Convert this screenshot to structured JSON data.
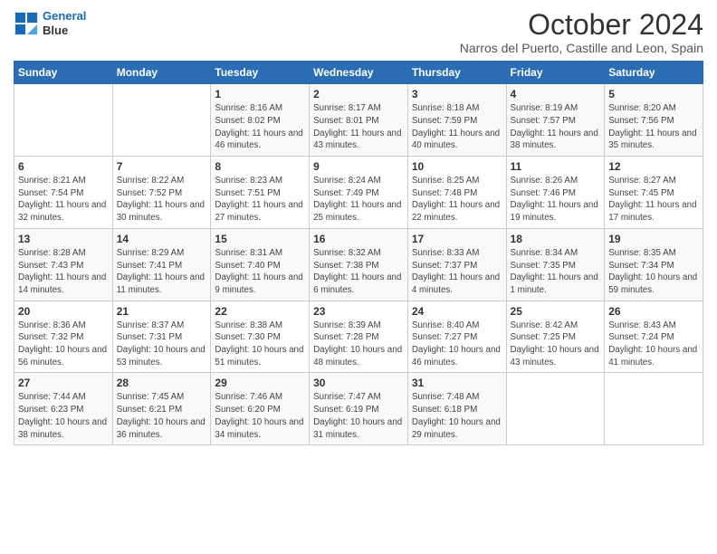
{
  "header": {
    "logo_line1": "General",
    "logo_line2": "Blue",
    "title": "October 2024",
    "subtitle": "Narros del Puerto, Castille and Leon, Spain"
  },
  "calendar": {
    "days_of_week": [
      "Sunday",
      "Monday",
      "Tuesday",
      "Wednesday",
      "Thursday",
      "Friday",
      "Saturday"
    ],
    "weeks": [
      [
        {
          "day": "",
          "info": ""
        },
        {
          "day": "",
          "info": ""
        },
        {
          "day": "1",
          "info": "Sunrise: 8:16 AM\nSunset: 8:02 PM\nDaylight: 11 hours and 46 minutes."
        },
        {
          "day": "2",
          "info": "Sunrise: 8:17 AM\nSunset: 8:01 PM\nDaylight: 11 hours and 43 minutes."
        },
        {
          "day": "3",
          "info": "Sunrise: 8:18 AM\nSunset: 7:59 PM\nDaylight: 11 hours and 40 minutes."
        },
        {
          "day": "4",
          "info": "Sunrise: 8:19 AM\nSunset: 7:57 PM\nDaylight: 11 hours and 38 minutes."
        },
        {
          "day": "5",
          "info": "Sunrise: 8:20 AM\nSunset: 7:56 PM\nDaylight: 11 hours and 35 minutes."
        }
      ],
      [
        {
          "day": "6",
          "info": "Sunrise: 8:21 AM\nSunset: 7:54 PM\nDaylight: 11 hours and 32 minutes."
        },
        {
          "day": "7",
          "info": "Sunrise: 8:22 AM\nSunset: 7:52 PM\nDaylight: 11 hours and 30 minutes."
        },
        {
          "day": "8",
          "info": "Sunrise: 8:23 AM\nSunset: 7:51 PM\nDaylight: 11 hours and 27 minutes."
        },
        {
          "day": "9",
          "info": "Sunrise: 8:24 AM\nSunset: 7:49 PM\nDaylight: 11 hours and 25 minutes."
        },
        {
          "day": "10",
          "info": "Sunrise: 8:25 AM\nSunset: 7:48 PM\nDaylight: 11 hours and 22 minutes."
        },
        {
          "day": "11",
          "info": "Sunrise: 8:26 AM\nSunset: 7:46 PM\nDaylight: 11 hours and 19 minutes."
        },
        {
          "day": "12",
          "info": "Sunrise: 8:27 AM\nSunset: 7:45 PM\nDaylight: 11 hours and 17 minutes."
        }
      ],
      [
        {
          "day": "13",
          "info": "Sunrise: 8:28 AM\nSunset: 7:43 PM\nDaylight: 11 hours and 14 minutes."
        },
        {
          "day": "14",
          "info": "Sunrise: 8:29 AM\nSunset: 7:41 PM\nDaylight: 11 hours and 11 minutes."
        },
        {
          "day": "15",
          "info": "Sunrise: 8:31 AM\nSunset: 7:40 PM\nDaylight: 11 hours and 9 minutes."
        },
        {
          "day": "16",
          "info": "Sunrise: 8:32 AM\nSunset: 7:38 PM\nDaylight: 11 hours and 6 minutes."
        },
        {
          "day": "17",
          "info": "Sunrise: 8:33 AM\nSunset: 7:37 PM\nDaylight: 11 hours and 4 minutes."
        },
        {
          "day": "18",
          "info": "Sunrise: 8:34 AM\nSunset: 7:35 PM\nDaylight: 11 hours and 1 minute."
        },
        {
          "day": "19",
          "info": "Sunrise: 8:35 AM\nSunset: 7:34 PM\nDaylight: 10 hours and 59 minutes."
        }
      ],
      [
        {
          "day": "20",
          "info": "Sunrise: 8:36 AM\nSunset: 7:32 PM\nDaylight: 10 hours and 56 minutes."
        },
        {
          "day": "21",
          "info": "Sunrise: 8:37 AM\nSunset: 7:31 PM\nDaylight: 10 hours and 53 minutes."
        },
        {
          "day": "22",
          "info": "Sunrise: 8:38 AM\nSunset: 7:30 PM\nDaylight: 10 hours and 51 minutes."
        },
        {
          "day": "23",
          "info": "Sunrise: 8:39 AM\nSunset: 7:28 PM\nDaylight: 10 hours and 48 minutes."
        },
        {
          "day": "24",
          "info": "Sunrise: 8:40 AM\nSunset: 7:27 PM\nDaylight: 10 hours and 46 minutes."
        },
        {
          "day": "25",
          "info": "Sunrise: 8:42 AM\nSunset: 7:25 PM\nDaylight: 10 hours and 43 minutes."
        },
        {
          "day": "26",
          "info": "Sunrise: 8:43 AM\nSunset: 7:24 PM\nDaylight: 10 hours and 41 minutes."
        }
      ],
      [
        {
          "day": "27",
          "info": "Sunrise: 7:44 AM\nSunset: 6:23 PM\nDaylight: 10 hours and 38 minutes."
        },
        {
          "day": "28",
          "info": "Sunrise: 7:45 AM\nSunset: 6:21 PM\nDaylight: 10 hours and 36 minutes."
        },
        {
          "day": "29",
          "info": "Sunrise: 7:46 AM\nSunset: 6:20 PM\nDaylight: 10 hours and 34 minutes."
        },
        {
          "day": "30",
          "info": "Sunrise: 7:47 AM\nSunset: 6:19 PM\nDaylight: 10 hours and 31 minutes."
        },
        {
          "day": "31",
          "info": "Sunrise: 7:48 AM\nSunset: 6:18 PM\nDaylight: 10 hours and 29 minutes."
        },
        {
          "day": "",
          "info": ""
        },
        {
          "day": "",
          "info": ""
        }
      ]
    ]
  }
}
